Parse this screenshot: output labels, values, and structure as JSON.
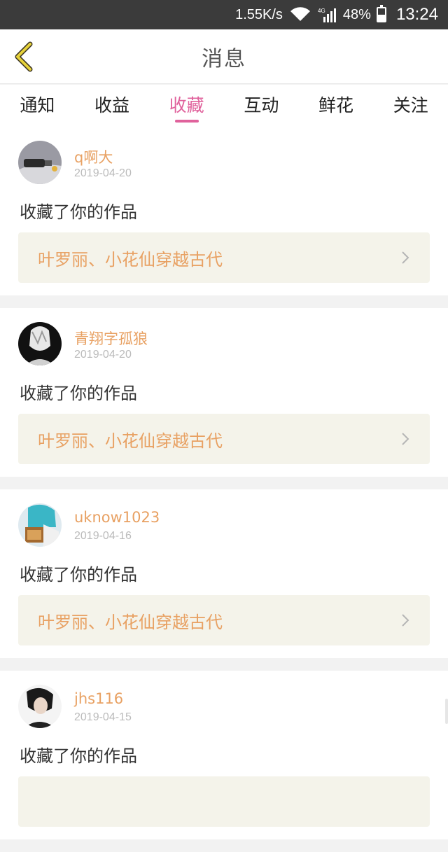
{
  "status_bar": {
    "network_speed": "1.55K/s",
    "signal_label": "4G",
    "battery_percent": "48%",
    "time": "13:24"
  },
  "header": {
    "title": "消息",
    "back_icon": "chevron-left-icon"
  },
  "tabs": [
    {
      "label": "通知",
      "active": false
    },
    {
      "label": "收益",
      "active": false
    },
    {
      "label": "收藏",
      "active": true
    },
    {
      "label": "互动",
      "active": false
    },
    {
      "label": "鲜花",
      "active": false
    },
    {
      "label": "关注",
      "active": false
    }
  ],
  "feed": [
    {
      "username": "q啊大",
      "date": "2019-04-20",
      "action": "收藏了你的作品",
      "work_title": "叶罗丽、小花仙穿越古代"
    },
    {
      "username": "青翔字孤狼",
      "date": "2019-04-20",
      "action": "收藏了你的作品",
      "work_title": "叶罗丽、小花仙穿越古代"
    },
    {
      "username": "uknow1023",
      "date": "2019-04-16",
      "action": "收藏了你的作品",
      "work_title": "叶罗丽、小花仙穿越古代"
    },
    {
      "username": "jhs116",
      "date": "2019-04-15",
      "action": "收藏了你的作品",
      "work_title": ""
    }
  ],
  "colors": {
    "accent": "#e0629c",
    "username": "#e8a163",
    "back_icon": "#e6d23a"
  }
}
